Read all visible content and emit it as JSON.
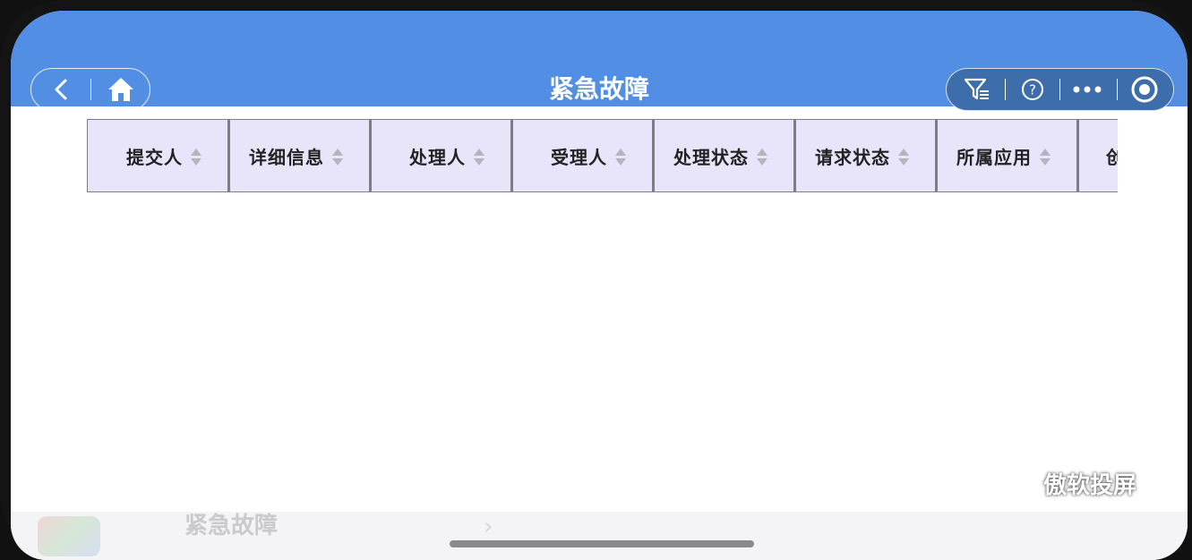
{
  "header": {
    "title": "紧急故障",
    "background_color": "#528fe4"
  },
  "nav": {
    "back_icon": "chevron-left-icon",
    "home_icon": "home-icon"
  },
  "menu": {
    "filter_icon": "filter-icon",
    "help_icon": "help-icon",
    "more_icon": "more-dots-icon",
    "close_icon": "record-circle-icon"
  },
  "table": {
    "header_bg": "#e8e5fb",
    "columns": [
      {
        "label": "提交人"
      },
      {
        "label": "详细信息"
      },
      {
        "label": "处理人"
      },
      {
        "label": "受理人"
      },
      {
        "label": "处理状态"
      },
      {
        "label": "请求状态"
      },
      {
        "label": "所属应用"
      },
      {
        "label": "创"
      }
    ]
  },
  "background_page": {
    "title": "紧急故障"
  },
  "watermark": "傲软投屏"
}
